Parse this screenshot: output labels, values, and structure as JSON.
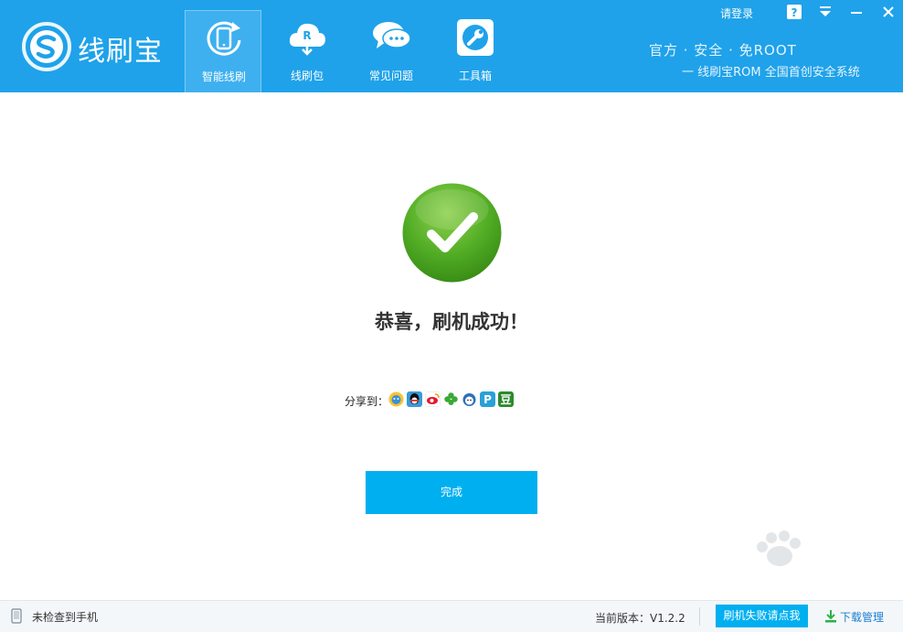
{
  "app": {
    "name": "线刷宝",
    "login": "请登录",
    "slogan_line1": "官方 · 安全 · 免ROOT",
    "slogan_line2": "一 线刷宝ROM 全国首创安全系统"
  },
  "nav": [
    {
      "label": "智能线刷",
      "icon": "phone-refresh-icon",
      "active": true
    },
    {
      "label": "线刷包",
      "icon": "cloud-download-icon",
      "active": false
    },
    {
      "label": "常见问题",
      "icon": "chat-bubbles-icon",
      "active": false
    },
    {
      "label": "工具箱",
      "icon": "wrench-icon",
      "active": false
    }
  ],
  "window_controls": [
    "help-icon",
    "menu-dropdown-icon",
    "minimize-icon",
    "close-icon"
  ],
  "main": {
    "success_title": "恭喜，刷机成功！",
    "share_label": "分享到：",
    "share_icons": [
      "qzone-icon",
      "qq-icon",
      "weibo-icon",
      "clover-icon",
      "renren-icon",
      "tencent-p-icon",
      "douban-icon"
    ],
    "done_button": "完成"
  },
  "statusbar": {
    "device_status": "未检查到手机",
    "version_label": "当前版本：V1.2.2",
    "help_button": "刷机失败请点我",
    "download_manager": "下载管理"
  },
  "colors": {
    "header_bg": "#1fa2ea",
    "accent_button": "#00aff0",
    "success_green": "#4ea724"
  }
}
